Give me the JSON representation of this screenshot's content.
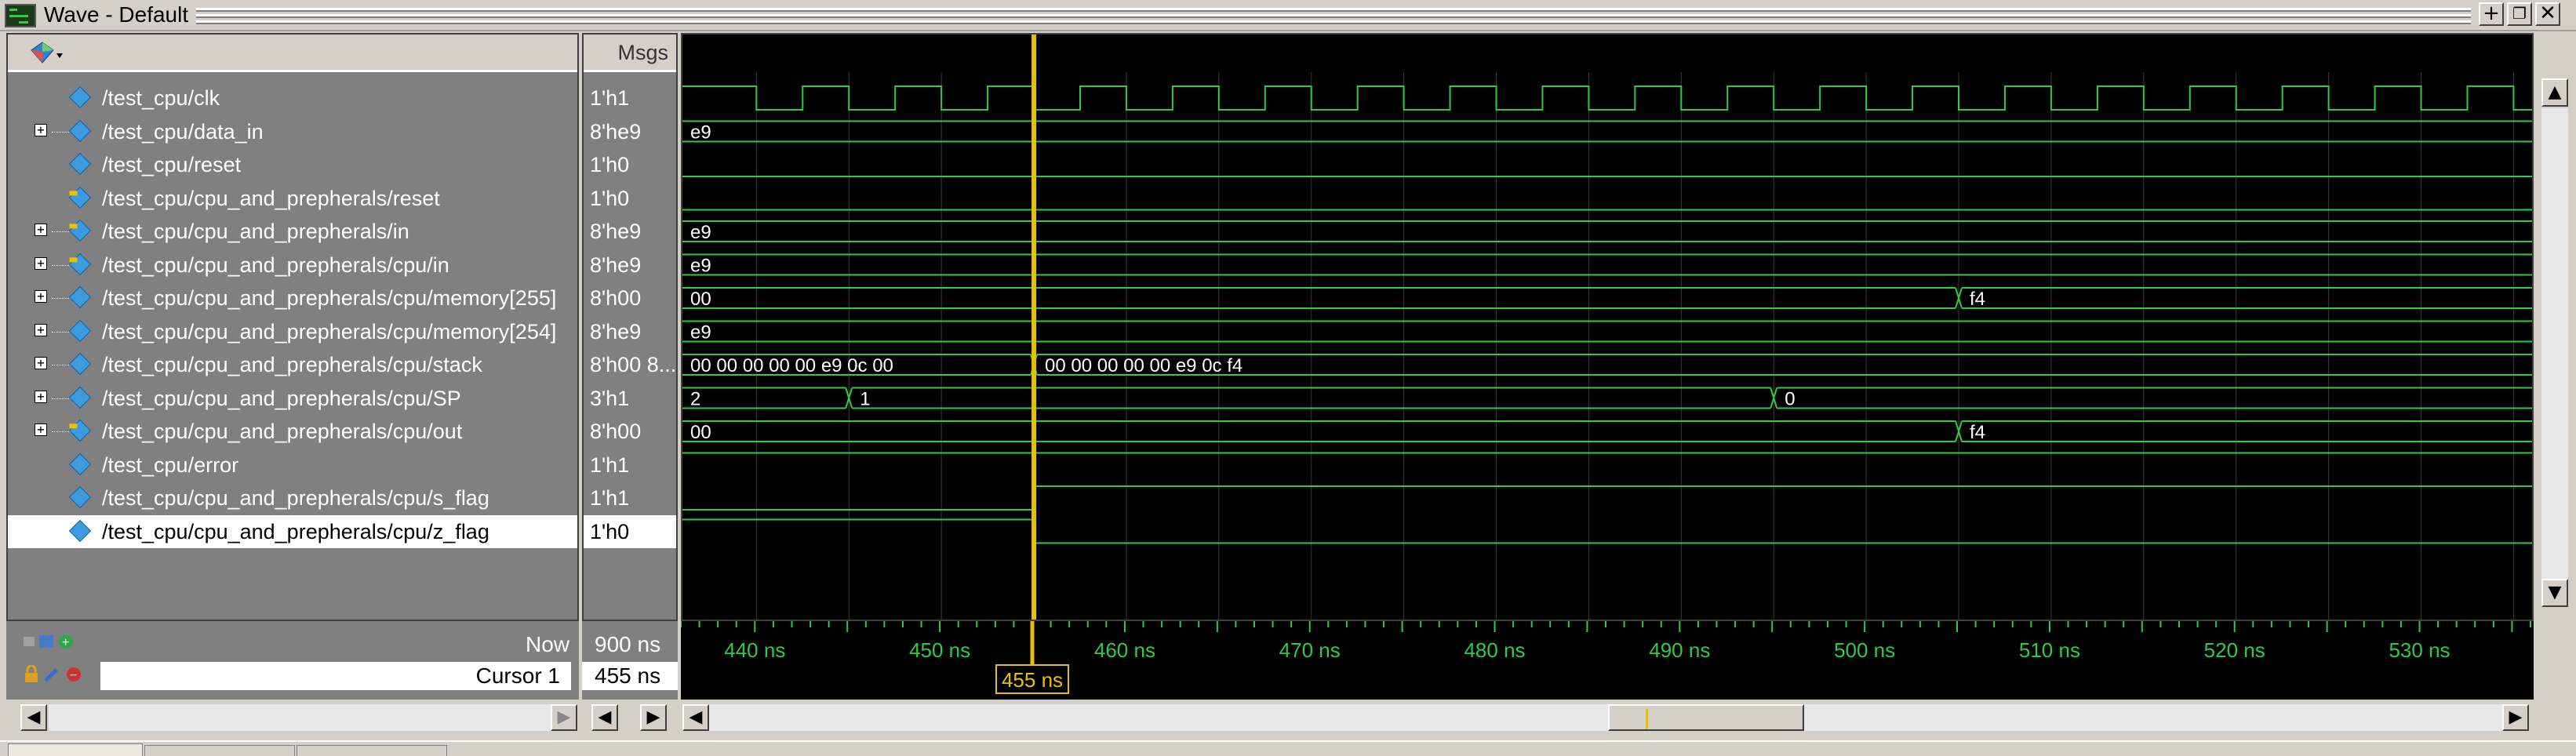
{
  "window": {
    "title": "Wave - Default"
  },
  "columns": {
    "msgs_header": "Msgs"
  },
  "signals": [
    {
      "name": "/test_cpu/clk",
      "value": "1'h1",
      "expandable": false,
      "icon": "signal-diamond-icon"
    },
    {
      "name": "/test_cpu/data_in",
      "value": "8'he9",
      "expandable": true,
      "icon": "signal-diamond-icon"
    },
    {
      "name": "/test_cpu/reset",
      "value": "1'h0",
      "expandable": false,
      "icon": "signal-diamond-icon"
    },
    {
      "name": "/test_cpu/cpu_and_prepherals/reset",
      "value": "1'h0",
      "expandable": false,
      "icon": "signal-inout-icon"
    },
    {
      "name": "/test_cpu/cpu_and_prepherals/in",
      "value": "8'he9",
      "expandable": true,
      "icon": "signal-inout-icon"
    },
    {
      "name": "/test_cpu/cpu_and_prepherals/cpu/in",
      "value": "8'he9",
      "expandable": true,
      "icon": "signal-inout-icon"
    },
    {
      "name": "/test_cpu/cpu_and_prepherals/cpu/memory[255]",
      "value": "8'h00",
      "expandable": true,
      "icon": "signal-diamond-icon"
    },
    {
      "name": "/test_cpu/cpu_and_prepherals/cpu/memory[254]",
      "value": "8'he9",
      "expandable": true,
      "icon": "signal-diamond-icon"
    },
    {
      "name": "/test_cpu/cpu_and_prepherals/cpu/stack",
      "value": "8'h00 8...",
      "expandable": true,
      "icon": "signal-diamond-icon"
    },
    {
      "name": "/test_cpu/cpu_and_prepherals/cpu/SP",
      "value": "3'h1",
      "expandable": true,
      "icon": "signal-diamond-icon"
    },
    {
      "name": "/test_cpu/cpu_and_prepherals/cpu/out",
      "value": "8'h00",
      "expandable": true,
      "icon": "signal-output-icon"
    },
    {
      "name": "/test_cpu/error",
      "value": "1'h1",
      "expandable": false,
      "icon": "signal-diamond-icon"
    },
    {
      "name": "/test_cpu/cpu_and_prepherals/cpu/s_flag",
      "value": "1'h1",
      "expandable": false,
      "icon": "signal-diamond-icon"
    },
    {
      "name": "/test_cpu/cpu_and_prepherals/cpu/z_flag",
      "value": "1'h0",
      "expandable": false,
      "icon": "signal-diamond-icon",
      "selected": true
    }
  ],
  "waves": {
    "view_start_ns": 436,
    "view_end_ns": 536,
    "clk_half_period_ns": 2.5,
    "clk_first_edge_ns": 440,
    "buses": [
      {
        "row": 1,
        "segments": [
          {
            "t": 436,
            "label": "e9"
          }
        ]
      },
      {
        "row": 4,
        "segments": [
          {
            "t": 436,
            "label": "e9"
          }
        ]
      },
      {
        "row": 5,
        "segments": [
          {
            "t": 436,
            "label": "e9"
          }
        ]
      },
      {
        "row": 6,
        "segments": [
          {
            "t": 436,
            "label": "00"
          },
          {
            "t": 505,
            "label": "f4"
          }
        ]
      },
      {
        "row": 7,
        "segments": [
          {
            "t": 436,
            "label": "e9"
          }
        ]
      },
      {
        "row": 8,
        "segments": [
          {
            "t": 436,
            "label": "00 00 00 00 00 e9 0c 00"
          },
          {
            "t": 455,
            "label": "00 00 00 00 00 e9 0c f4"
          }
        ]
      },
      {
        "row": 9,
        "segments": [
          {
            "t": 436,
            "label": "2"
          },
          {
            "t": 445,
            "label": "1"
          },
          {
            "t": 495,
            "label": "0"
          }
        ]
      },
      {
        "row": 10,
        "segments": [
          {
            "t": 436,
            "label": "00"
          },
          {
            "t": 505,
            "label": "f4"
          }
        ]
      }
    ],
    "bits": [
      {
        "row": 2,
        "level": 0
      },
      {
        "row": 3,
        "level": 0
      },
      {
        "row": 11,
        "level": 1
      },
      {
        "row": 12,
        "level": 0,
        "rise_at": 455
      },
      {
        "row": 13,
        "level": 1,
        "fall_at": 455
      }
    ]
  },
  "timeline": {
    "ticks": [
      "440 ns",
      "450 ns",
      "460 ns",
      "470 ns",
      "480 ns",
      "490 ns",
      "500 ns",
      "510 ns",
      "520 ns",
      "530 ns"
    ],
    "tick_values_ns": [
      440,
      450,
      460,
      470,
      480,
      490,
      500,
      510,
      520,
      530
    ]
  },
  "footer": {
    "now_label": "Now",
    "now_value": "900 ns",
    "cursor_label": "Cursor 1",
    "cursor_value": "455 ns",
    "cursor_time_ns": 455,
    "cursor_flag": "455 ns"
  },
  "colors": {
    "wave_green": "#2ecc40",
    "cursor_yellow": "#e8c000",
    "timeline_text": "#2ecc40"
  }
}
